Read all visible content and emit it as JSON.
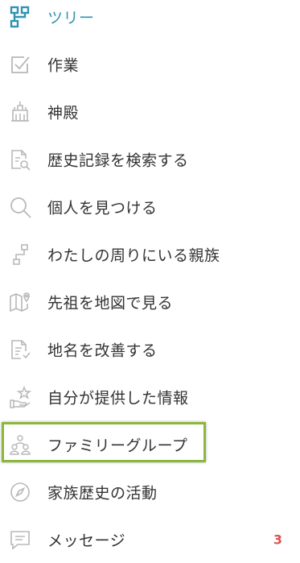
{
  "menu": {
    "items": [
      {
        "icon": "tree-icon",
        "label": "ツリー",
        "active": true
      },
      {
        "icon": "tasks-icon",
        "label": "作業"
      },
      {
        "icon": "temple-icon",
        "label": "神殿"
      },
      {
        "icon": "search-records-icon",
        "label": "歴史記録を検索する"
      },
      {
        "icon": "magnifier-icon",
        "label": "個人を見つける"
      },
      {
        "icon": "relatives-around-me-icon",
        "label": "わたしの周りにいる親族"
      },
      {
        "icon": "map-pin-icon",
        "label": "先祖を地図で見る"
      },
      {
        "icon": "improve-places-icon",
        "label": "地名を改善する"
      },
      {
        "icon": "contributions-icon",
        "label": "自分が提供した情報"
      },
      {
        "icon": "family-group-icon",
        "label": "ファミリーグループ",
        "highlighted": true
      },
      {
        "icon": "compass-icon",
        "label": "家族歴史の活動"
      },
      {
        "icon": "messages-icon",
        "label": "メッセージ",
        "badge": "3"
      }
    ]
  },
  "colors": {
    "active_text": "#2f93b2",
    "text": "#333333",
    "icon": "#b8b8b8",
    "badge": "#d9534f",
    "highlight_border": "#8bb83c"
  }
}
